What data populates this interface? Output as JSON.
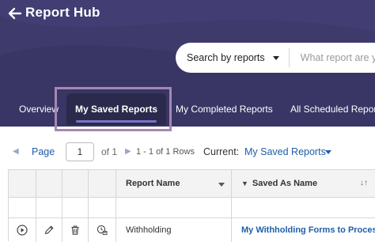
{
  "header": {
    "title": "Report Hub",
    "back_icon": "arrow-left-icon",
    "background_color": "#3e3a6c"
  },
  "search": {
    "type_label": "Search by reports",
    "placeholder": "What report are y"
  },
  "tabs": [
    {
      "label": "Overview",
      "active": false
    },
    {
      "label": "My Saved Reports",
      "active": true
    },
    {
      "label": "My Completed Reports",
      "active": false
    },
    {
      "label": "All Scheduled Reports",
      "active": false
    }
  ],
  "pager": {
    "page_label": "Page",
    "page_value": "1",
    "of_total": "of 1",
    "rows_info": "1 - 1 of 1 Rows",
    "current_label": "Current:",
    "current_value": "My Saved Reports"
  },
  "grid": {
    "columns": [
      {
        "label": ""
      },
      {
        "label": ""
      },
      {
        "label": ""
      },
      {
        "label": ""
      },
      {
        "label": "Report Name"
      },
      {
        "label": "Saved As Name"
      }
    ],
    "rows": [
      {
        "report_name": "Withholding",
        "saved_as_name": "My Withholding Forms to Process",
        "actions": [
          "play-icon",
          "pencil-icon",
          "trash-icon",
          "schedule-icon"
        ]
      }
    ]
  },
  "colors": {
    "accent_link": "#1f5ea8",
    "active_tab": "#2b2a4c",
    "highlight_box": "#a389b0"
  }
}
